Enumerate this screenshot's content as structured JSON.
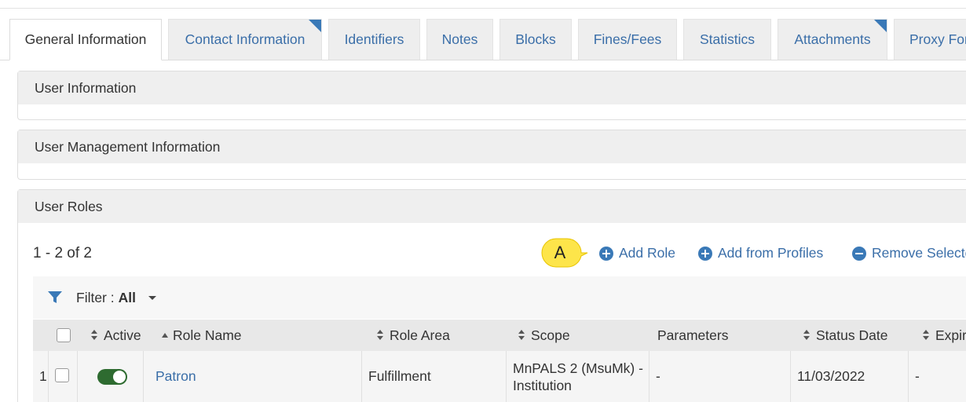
{
  "tabs": [
    {
      "label": "General Information",
      "active": true
    },
    {
      "label": "Contact Information",
      "corner": true
    },
    {
      "label": "Identifiers"
    },
    {
      "label": "Notes"
    },
    {
      "label": "Blocks"
    },
    {
      "label": "Fines/Fees"
    },
    {
      "label": "Statistics"
    },
    {
      "label": "Attachments",
      "corner": true
    },
    {
      "label": "Proxy For"
    }
  ],
  "sections": {
    "user_information": "User Information",
    "user_management": "User Management Information",
    "user_roles": "User Roles"
  },
  "roles": {
    "count_text": "1 - 2 of 2",
    "callout_label": "A",
    "actions": {
      "add_role": "Add Role",
      "add_from_profiles": "Add from Profiles",
      "remove_selected": "Remove Selected"
    },
    "filter": {
      "label": "Filter :",
      "value": "All"
    },
    "columns": {
      "active": "Active",
      "role_name": "Role Name",
      "role_area": "Role Area",
      "scope": "Scope",
      "parameters": "Parameters",
      "status_date": "Status Date",
      "expiry": "Expiry"
    },
    "rows": [
      {
        "index": "1",
        "active": true,
        "role_name": "Patron",
        "role_area": "Fulfillment",
        "scope": "MnPALS 2 (MsuMk) - Institution",
        "parameters": "-",
        "status_date": "11/03/2022",
        "expiry": "-"
      }
    ]
  },
  "colors": {
    "accent": "#3a79b7",
    "link": "#3a6ea8",
    "toggle_on": "#2e6b30",
    "callout": "#fde54a"
  }
}
